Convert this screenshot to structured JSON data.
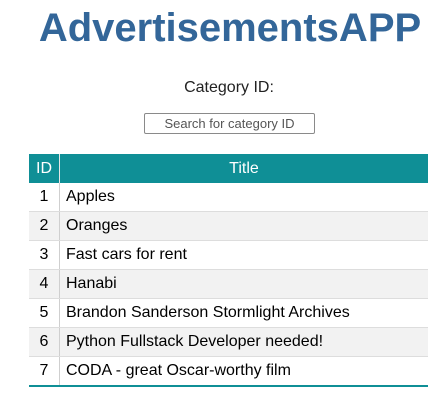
{
  "app": {
    "title": "AdvertisementsAPP"
  },
  "filter": {
    "label": "Category ID:",
    "placeholder": "Search for category ID",
    "value": ""
  },
  "table": {
    "columns": {
      "id": "ID",
      "title": "Title"
    },
    "rows": [
      {
        "id": "1",
        "title": "Apples"
      },
      {
        "id": "2",
        "title": "Oranges"
      },
      {
        "id": "3",
        "title": "Fast cars for rent"
      },
      {
        "id": "4",
        "title": "Hanabi"
      },
      {
        "id": "5",
        "title": "Brandon Sanderson Stormlight Archives"
      },
      {
        "id": "6",
        "title": "Python Fullstack Developer needed!"
      },
      {
        "id": "7",
        "title": "CODA - great Oscar-worthy film"
      }
    ]
  },
  "colors": {
    "title": "#336699",
    "header": "#0f8f96",
    "stripe": "#f2f2f2"
  }
}
